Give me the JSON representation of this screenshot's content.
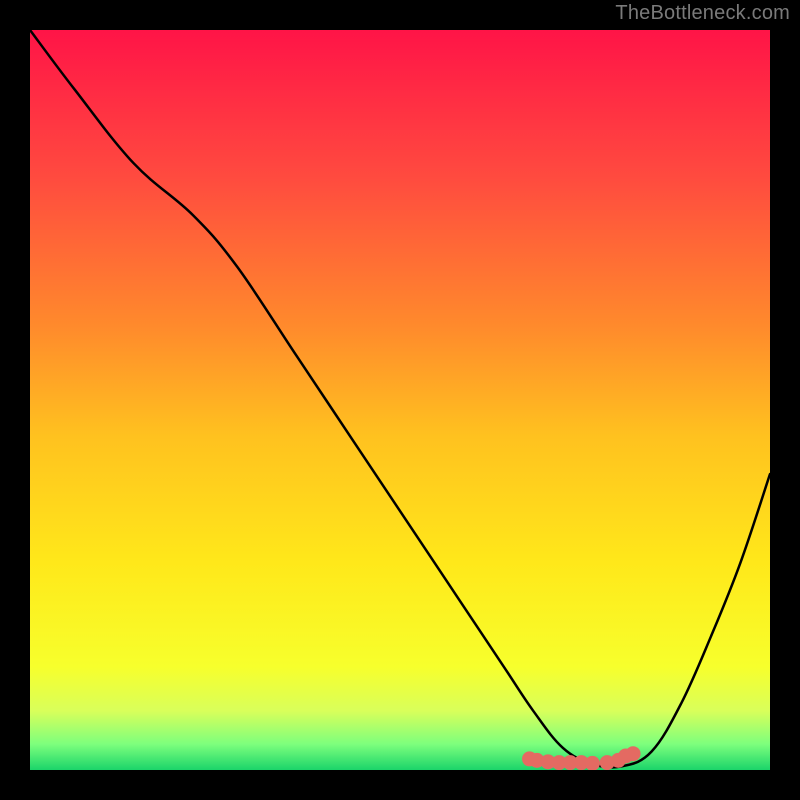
{
  "attribution": "TheBottleneck.com",
  "chart_data": {
    "type": "line",
    "title": "",
    "xlabel": "",
    "ylabel": "",
    "xlim": [
      0,
      100
    ],
    "ylim": [
      0,
      100
    ],
    "grid": false,
    "legend": false,
    "background_gradient": {
      "direction": "vertical_top_to_bottom",
      "stops": [
        {
          "offset": 0.0,
          "color": "#ff1447"
        },
        {
          "offset": 0.2,
          "color": "#ff4b3f"
        },
        {
          "offset": 0.4,
          "color": "#ff8a2c"
        },
        {
          "offset": 0.55,
          "color": "#ffc21f"
        },
        {
          "offset": 0.72,
          "color": "#ffe81a"
        },
        {
          "offset": 0.86,
          "color": "#f7ff2c"
        },
        {
          "offset": 0.92,
          "color": "#d9ff5a"
        },
        {
          "offset": 0.965,
          "color": "#7dff7d"
        },
        {
          "offset": 1.0,
          "color": "#1bd46a"
        }
      ]
    },
    "series": [
      {
        "name": "bottleneck-curve",
        "color": "#000000",
        "width": 2.5,
        "x": [
          0,
          6,
          14,
          22,
          28,
          36,
          44,
          52,
          58,
          64,
          68,
          72,
          76,
          80,
          84,
          88,
          92,
          96,
          100
        ],
        "y": [
          100,
          92,
          82,
          75,
          68,
          56,
          44,
          32,
          23,
          14,
          8,
          3,
          0.8,
          0.5,
          2.5,
          9,
          18,
          28,
          40
        ]
      }
    ],
    "markers": {
      "name": "optimal-range",
      "color": "#e46a62",
      "radius": 7.5,
      "x": [
        67.5,
        68.5,
        70.0,
        71.5,
        73.0,
        74.5,
        76.0,
        78.0,
        79.5,
        80.5,
        81.5
      ],
      "y": [
        1.5,
        1.3,
        1.1,
        1.0,
        1.0,
        1.0,
        0.9,
        1.0,
        1.3,
        1.9,
        2.2
      ]
    }
  }
}
